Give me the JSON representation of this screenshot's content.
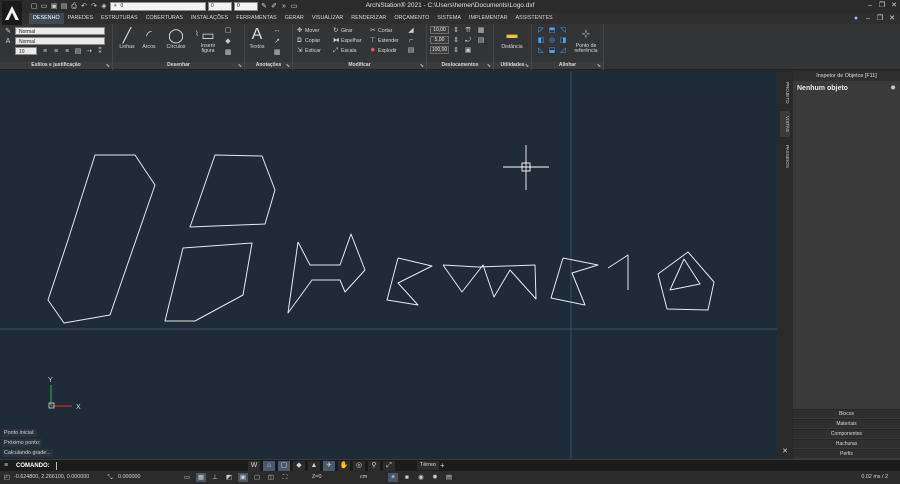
{
  "titlebar": {
    "title": "ArchiStation® 2021 - C:\\Users\\hemer\\Documents\\Logo.dxf",
    "layer_value": "0",
    "field_a": "0",
    "field_b": "0"
  },
  "menu": {
    "items": [
      "DESENHO",
      "PAREDES",
      "ESTRUTURAS",
      "COBERTURAS",
      "INSTALAÇÕES",
      "FERRAMENTAS",
      "GERAR",
      "VISUALIZAR",
      "RENDERIZAR",
      "ORÇAMENTO",
      "SISTEMA",
      "IMPLEMENTAR",
      "ASSISTENTES"
    ],
    "active": "DESENHO"
  },
  "ribbon": {
    "styles": {
      "label": "Estilos e justificação",
      "combo_1": "Normal",
      "combo_2": "Normal",
      "size_value": "10"
    },
    "draw": {
      "label": "Desenhar",
      "lines": "Linhas",
      "arcs": "Arcos",
      "circles": "Círculos",
      "insert_figure": "Inserir figura"
    },
    "annotations": {
      "label": "Anotações",
      "texts": "Textos"
    },
    "modify": {
      "label": "Modificar",
      "move": "Mover",
      "copy": "Copiar",
      "stretch": "Esticar",
      "rotate": "Girar",
      "mirror": "Espelhar",
      "scale": "Escala",
      "cut": "Cortar",
      "extend": "Estender",
      "explode": "Explodir"
    },
    "offsets": {
      "label": "Deslocamentos",
      "value_1": "10,00",
      "value_2": "5,00",
      "value_3": "100,00"
    },
    "utilities": {
      "label": "Utilidades",
      "distance": "Distância"
    },
    "align": {
      "label": "Alinhar",
      "ref_point": "Ponto de referência"
    }
  },
  "viewport": {
    "history": [
      "Ponto inicial:",
      "Próximo ponto:",
      "Calculando grade..."
    ],
    "ucs_x": "X",
    "ucs_y": "Y"
  },
  "side_tabs": [
    "PROJETO",
    "VISTAS",
    "PASSEIOS"
  ],
  "inspector": {
    "header": "Inspetor de Objetos [F11]",
    "title": "Nenhum objeto",
    "buttons": [
      "Blocos",
      "Materiais",
      "Componentes",
      "Hachuras",
      "Perfis"
    ]
  },
  "command": {
    "label": "COMANDO:",
    "value": ""
  },
  "floor_tab": "Térreo",
  "status": {
    "coords": "-0.624800, 2.266100, 0.000000",
    "angle": "0.000000",
    "z_value": "Z=0",
    "unit": "cm",
    "timing": "0.02 ms / 2"
  },
  "colors": {
    "viewport_bg": "#1f2b37",
    "shape_stroke": "#e6e9ee",
    "axis_y": "#39b54a",
    "axis_x": "#e0312f"
  }
}
